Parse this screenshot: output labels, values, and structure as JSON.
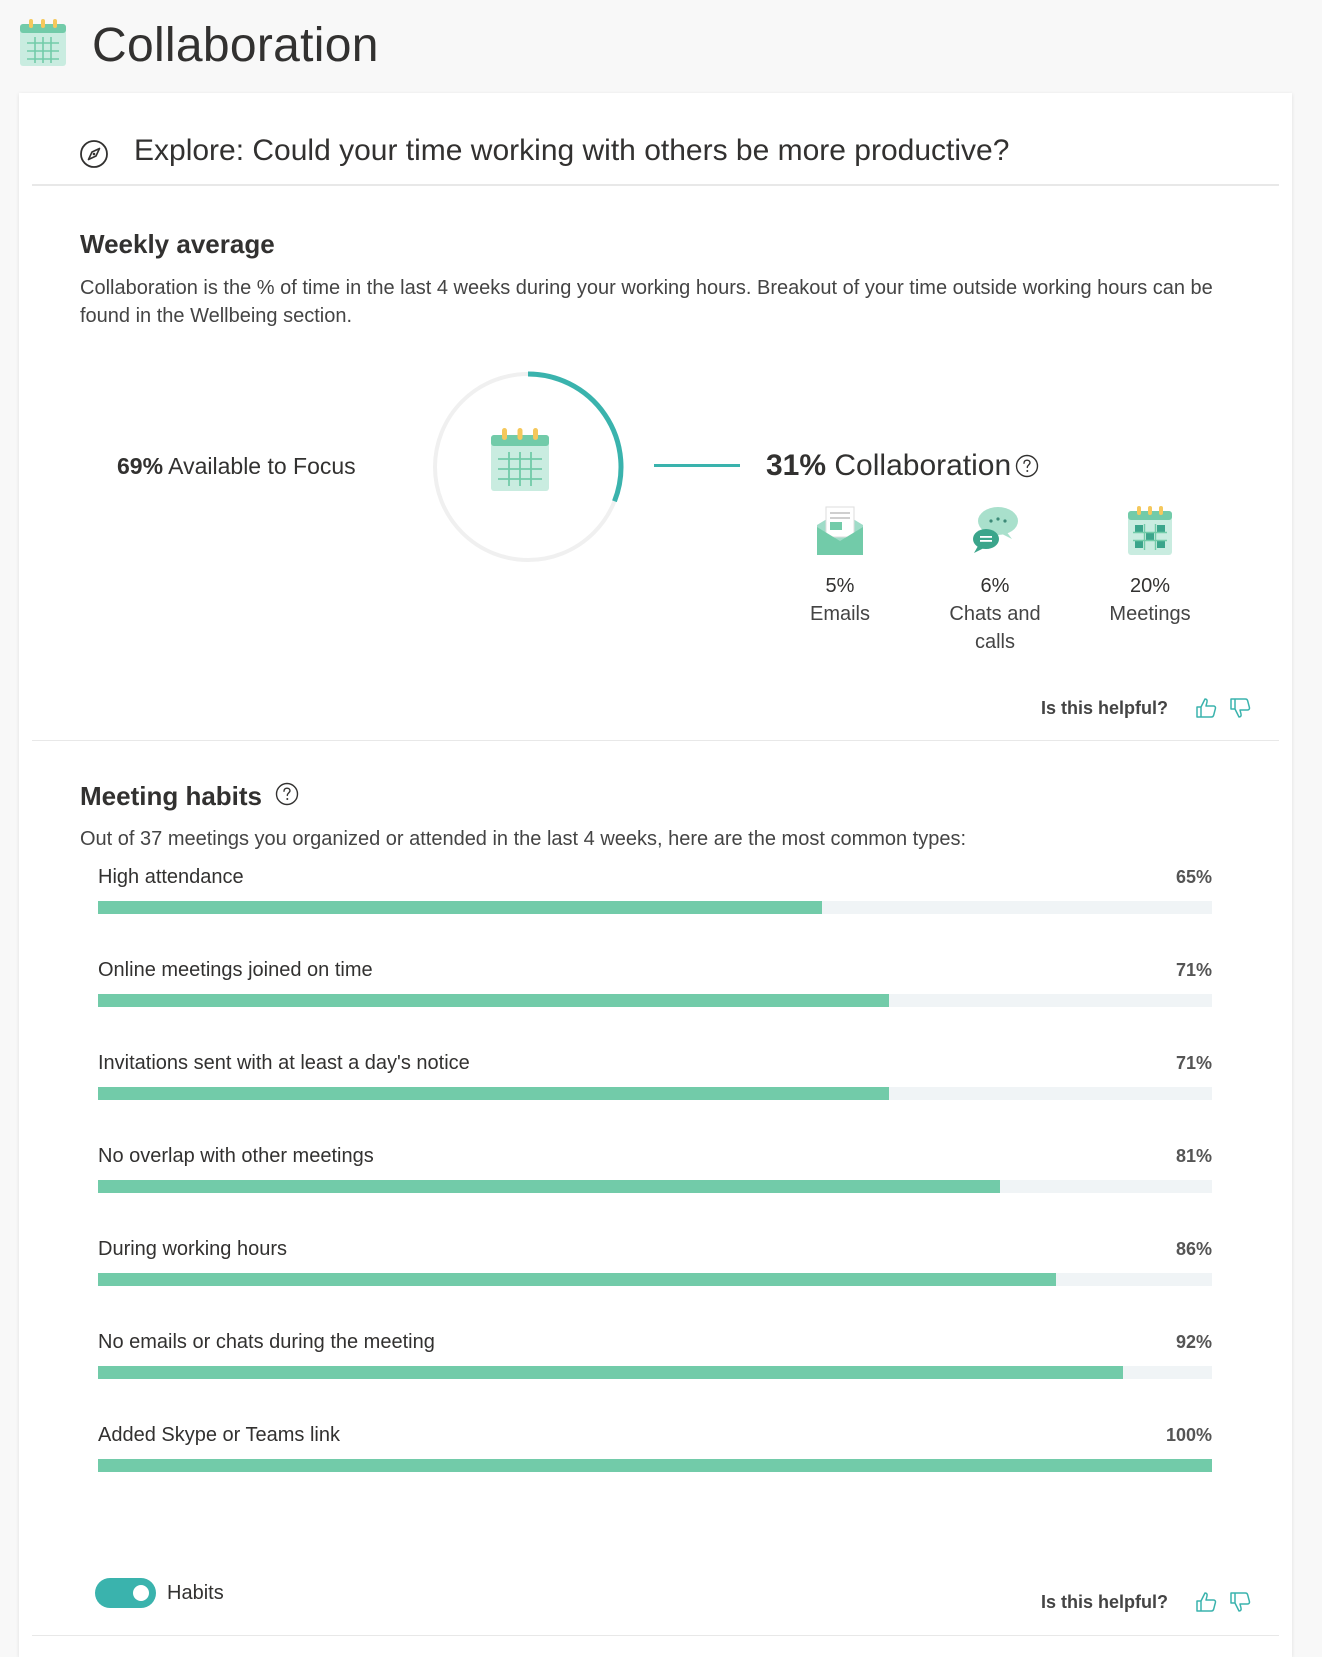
{
  "page": {
    "title": "Collaboration",
    "header_icon": "calendar-icon"
  },
  "explore": {
    "icon": "compass-icon",
    "text": "Explore: Could your time working with others be more productive?"
  },
  "weekly": {
    "title": "Weekly average",
    "description": "Collaboration is the % of time in the last 4 weeks during your working hours. Breakout of your time outside working hours can be found in the Wellbeing section.",
    "focus_pct": "69%",
    "focus_label": "Available to Focus",
    "collab_pct": "31%",
    "collab_label": "Collaboration",
    "collab_fraction": 0.31,
    "ring_color": "#3ab3ad",
    "breakdown": [
      {
        "pct": "5%",
        "label": "Emails",
        "icon": "envelope-icon"
      },
      {
        "pct": "6%",
        "label": "Chats and calls",
        "icon": "chat-bubbles-icon"
      },
      {
        "pct": "20%",
        "label": "Meetings",
        "icon": "calendar-icon"
      }
    ],
    "helpful": "Is this helpful?"
  },
  "habits": {
    "title": "Meeting habits",
    "description": "Out of 37 meetings you organized or attended in the last 4 weeks, here are the most common types:",
    "bar_color": "#72cba9",
    "items": [
      {
        "label": "High attendance",
        "value": "65%",
        "fraction": 0.65
      },
      {
        "label": "Online meetings joined on time",
        "value": "71%",
        "fraction": 0.71
      },
      {
        "label": "Invitations sent with at least a day's notice",
        "value": "71%",
        "fraction": 0.71
      },
      {
        "label": "No overlap with other meetings",
        "value": "81%",
        "fraction": 0.81
      },
      {
        "label": "During working hours",
        "value": "86%",
        "fraction": 0.86
      },
      {
        "label": "No emails or chats during the meeting",
        "value": "92%",
        "fraction": 0.92
      },
      {
        "label": "Added Skype or Teams link",
        "value": "100%",
        "fraction": 1.0
      }
    ],
    "toggle_label": "Habits",
    "toggle_on": true,
    "helpful": "Is this helpful?"
  }
}
